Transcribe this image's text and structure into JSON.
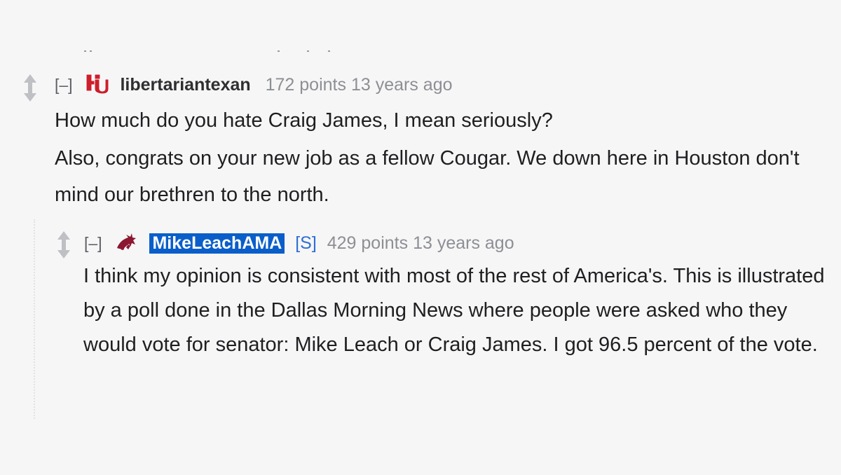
{
  "parent_comment": {
    "collapse_label": "[–]",
    "author": "libertariantexan",
    "score": "172 points",
    "timestamp": "13 years ago",
    "paragraphs": [
      "How much do you hate Craig James, I mean seriously?",
      "Also, congrats on your new job as a fellow Cougar. We down here in Houston don't mind our brethren to the north."
    ],
    "flair_icon": "houston-cougars-logo-icon",
    "flair_color": "#cc1f2b"
  },
  "reply_comment": {
    "collapse_label": "[–]",
    "author": "MikeLeachAMA",
    "submitter_tag": "[S]",
    "score": "429 points",
    "timestamp": "13 years ago",
    "paragraphs": [
      "I think my opinion is consistent with most of the rest of America's. This is illustrated by a poll done in the Dallas Morning News where people were asked who they would vote for senator: Mike Leach or Craig James. I got 96.5 percent of the vote."
    ],
    "flair_icon": "washington-state-cougar-logo-icon",
    "flair_color": "#8b1730",
    "author_highlight_color": "#0a5ec9"
  }
}
